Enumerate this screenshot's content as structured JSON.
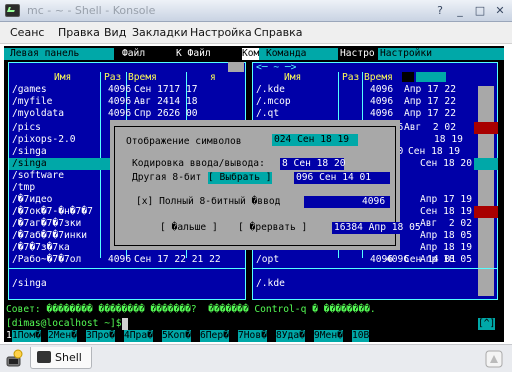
{
  "window": {
    "title": "mc - ~ - Shell - Konsole",
    "buttons": [
      "?",
      "_",
      "□",
      "✕"
    ]
  },
  "menu": [
    "Сеанс",
    "Правка",
    "Вид",
    "Закладки",
    "Настройка",
    "Справка"
  ],
  "mc_menubar": {
    "left_panel": "Левая панель",
    "file": "Файл",
    "command": "Ком",
    "command2": "Команда",
    "k_file": "К Файл",
    "settings": "Настро",
    "settings2": "Настройки"
  },
  "left_panel": {
    "path_bar": "",
    "headers": [
      "Имя",
      "Раз",
      "Время",
      "я"
    ],
    "rows": [
      {
        "name": "/games",
        "size": "4096",
        "time": "Сен 1717 17"
      },
      {
        "name": "/myfile",
        "size": "4096",
        "time": "Авг 2414 18"
      },
      {
        "name": "/myoldata",
        "size": "4096",
        "time": "Спр 2626 00"
      },
      {
        "name": "/pics",
        "size": "",
        "time": ""
      },
      {
        "name": "/pixops-2.0",
        "size": "",
        "time": ""
      },
      {
        "name": "/singa",
        "size": "",
        "time": ""
      },
      {
        "name": "/software",
        "size": "",
        "time": ""
      },
      {
        "name": "/tmp",
        "size": "",
        "time": ""
      },
      {
        "name": "/�7идео",
        "size": "",
        "time": ""
      },
      {
        "name": "/�7ок�7-�н�7�7",
        "size": "",
        "time": ""
      },
      {
        "name": "/�7аг�7�7зки",
        "size": "",
        "time": ""
      },
      {
        "name": "/�7аб�7�7инки",
        "size": "",
        "time": ""
      },
      {
        "name": "/�7�7з�7ка",
        "size": "",
        "time": ""
      },
      {
        "name": "/Рабо~�7�7ол",
        "size": "4096",
        "time": "Сен 17 22 21 22"
      }
    ],
    "footer": "/singa"
  },
  "right_panel": {
    "path_bar": "<─ ~ ─>",
    "headers": [
      "Имя",
      "Раз",
      "Время"
    ],
    "rows": [
      {
        "name": "/.kde",
        "size": "4096",
        "time": "Апр 17 22"
      },
      {
        "name": "/.mcop",
        "size": "4096",
        "time": "Апр 17 22"
      },
      {
        "name": "/.qt",
        "size": "4096",
        "time": "Апр 17 22"
      },
      {
        "name": "",
        "size": "096",
        "time": "Авг  2 02"
      },
      {
        "name": "",
        "size": "",
        "time": "18 19"
      },
      {
        "name": "",
        "size": "980",
        "time": "Сен 18 19"
      },
      {
        "name": "",
        "size": "",
        "time": "Сен 18 20"
      },
      {
        "name": "",
        "size": "",
        "time": "Апр 17 19"
      },
      {
        "name": "",
        "size": "4096",
        "time": "Сен 18 19"
      },
      {
        "name": "",
        "size": "",
        "time": "Авг  2 02"
      },
      {
        "name": "",
        "size": "",
        "time": "Апр 18 05"
      },
      {
        "name": "",
        "size": "",
        "time": "Апр 18 19"
      },
      {
        "name": "",
        "size": "4096",
        "time": "Апр 18 05"
      },
      {
        "name": "/opt",
        "size": "4096",
        "time": "Сен 14 01"
      }
    ],
    "footer": "/.kde"
  },
  "dialog": {
    "title": "Отображение символов",
    "encoding_label": "Кодировка ввода/вывода:",
    "other_label": "Другая 8-бит",
    "select_button": "[ Выбрать ]",
    "checkbox": "[x] Полный 8-битный �ввод",
    "more_button": "[ �альше ]",
    "interrupt_button": "[ �рервать ]",
    "ghost_1": "024 Сен 18 19",
    "ghost_2": "8 Сен 18 20",
    "ghost_3": "096 Сен 14 01",
    "ghost_4": "4096",
    "ghost_5": "16384 Апр 18 05"
  },
  "hint": "Совет: �������� �������� �������?  ������� Control-q � ��������.",
  "prompt": "[dimas@localhost ~]$",
  "prompt_tag": "[^]",
  "fkeys": [
    "1Пом�",
    "2Мен�",
    "3Про�",
    "4Пра�",
    "5Коп�",
    "6Пер�",
    "7Нов�",
    "8Уда�",
    "9Мен�",
    "10В"
  ],
  "tab": {
    "label": "Shell"
  },
  "colors": {
    "panel_blue": "#0000a8",
    "highlight_cyan": "#00a8a8",
    "dialog_gray": "#a8a8a8",
    "hint_green": "#54fc54",
    "red": "#a80000"
  }
}
